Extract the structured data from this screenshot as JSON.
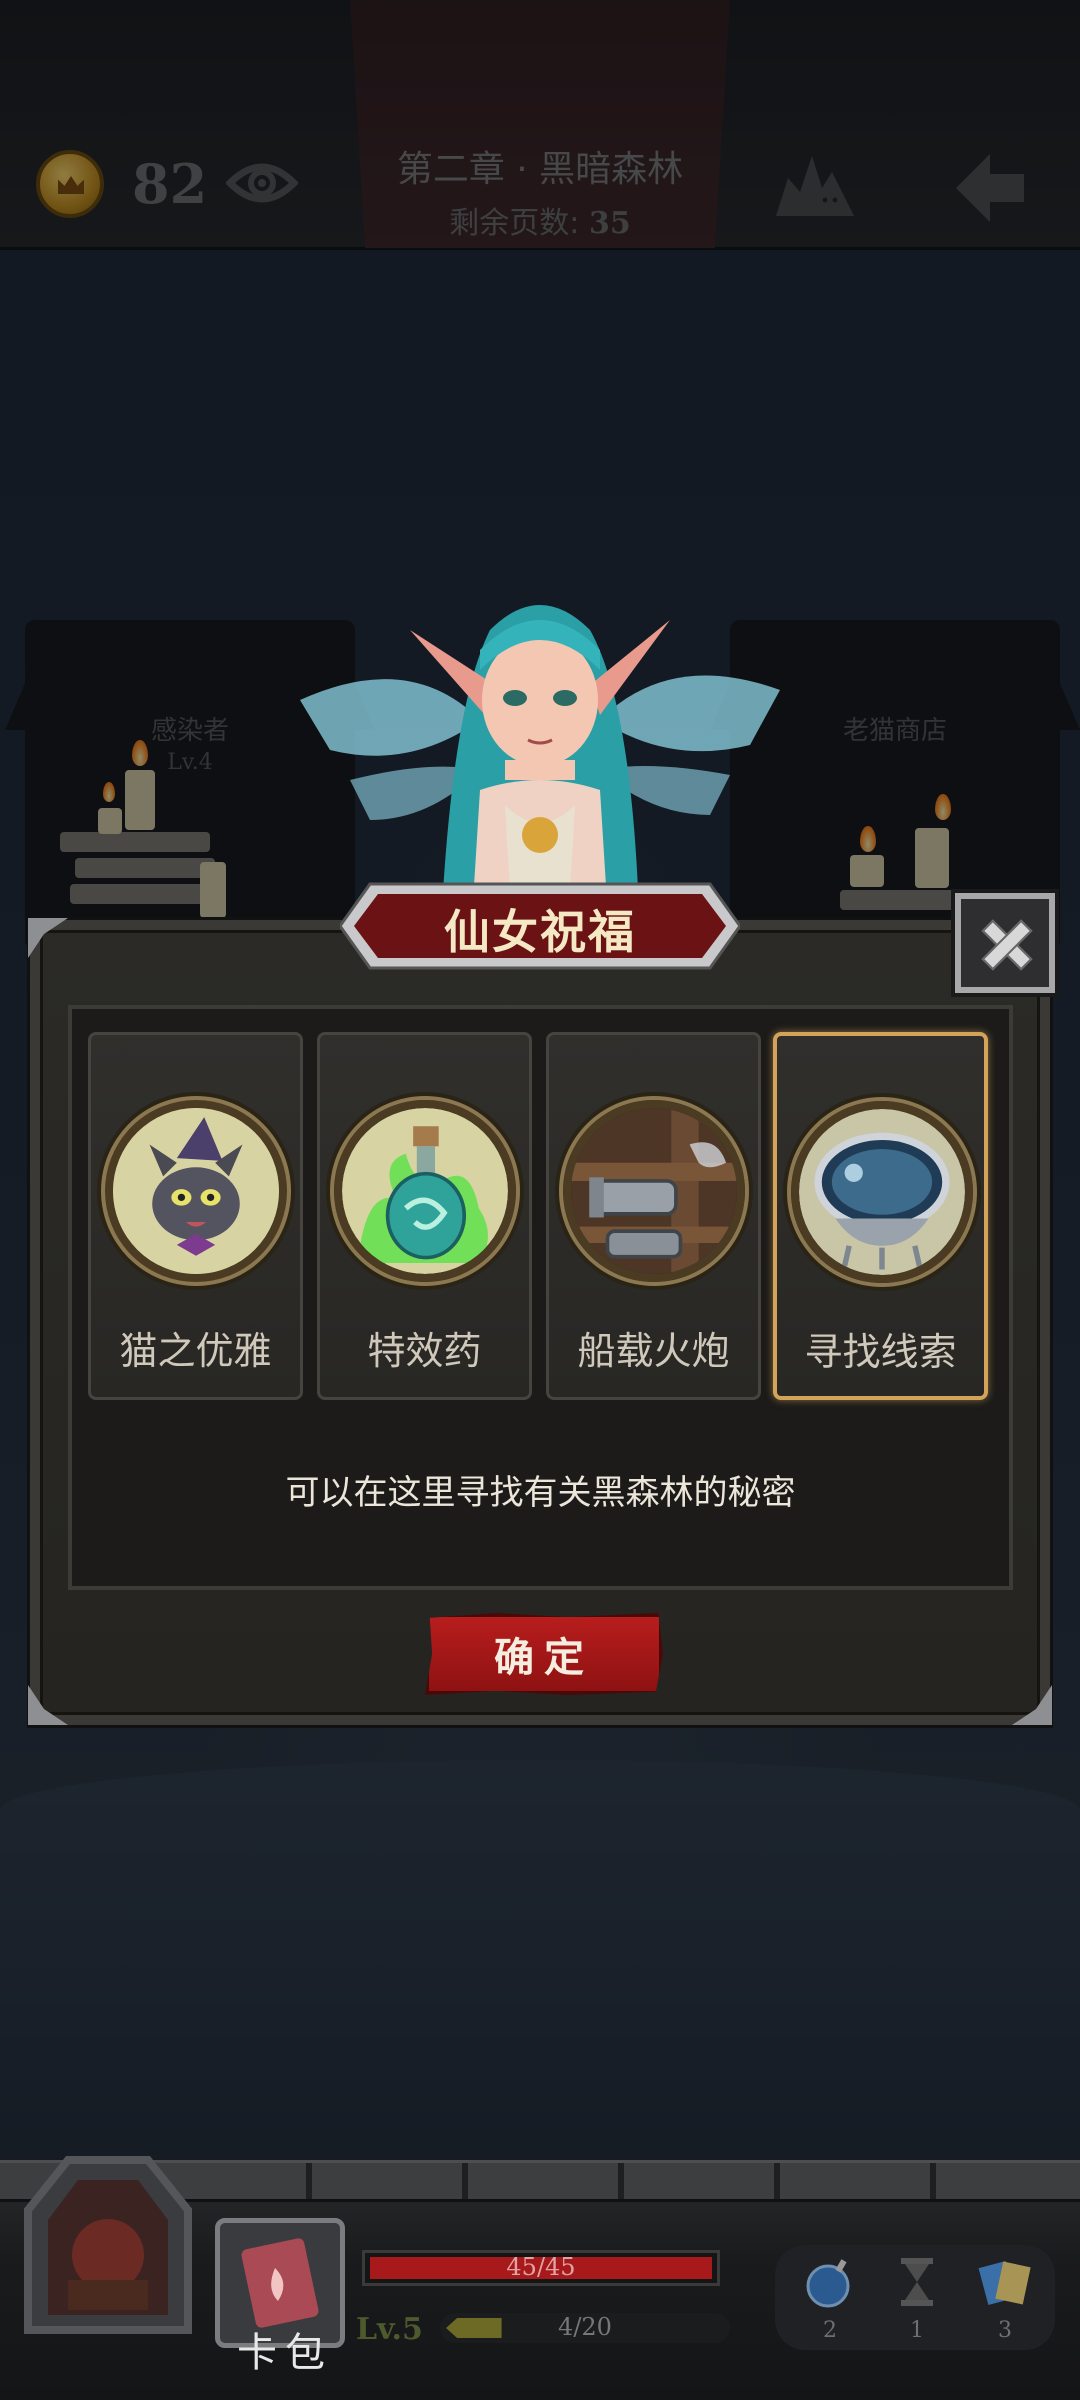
{
  "top_bar": {
    "coin_count": "82",
    "chapter_title": "第二章 · 黑暗森林",
    "pages_label": "剩余页数: ",
    "pages_value": "35"
  },
  "background_cards": [
    {
      "title": "感染者",
      "level": "Lv.4"
    },
    {
      "title": "老猫商店"
    }
  ],
  "dialog": {
    "title": "仙女祝福",
    "options": [
      {
        "label": "猫之优雅",
        "icon": "witch-cat-icon",
        "selected": false
      },
      {
        "label": "特效药",
        "icon": "green-potion-icon",
        "selected": false
      },
      {
        "label": "船载火炮",
        "icon": "ship-cannon-icon",
        "selected": false
      },
      {
        "label": "寻找线索",
        "icon": "crystal-ball-icon",
        "selected": true
      }
    ],
    "description": "可以在这里寻找有关黑森林的秘密",
    "confirm_label": "确定"
  },
  "bottom_bar": {
    "card_pack_label": "卡包",
    "hp_text": "45/45",
    "hp_fraction": 1.0,
    "level_text": "Lv.5",
    "xp_text": "4/20",
    "xp_fraction": 0.2,
    "inventory": [
      {
        "icon": "bomb-icon",
        "count": "2"
      },
      {
        "icon": "hourglass-icon",
        "count": "1"
      },
      {
        "icon": "cards-icon",
        "count": "3"
      }
    ]
  },
  "colors": {
    "accent_red": "#a8191b",
    "selected_border": "#d4a35a",
    "dialog_bg": "#2b2a26"
  }
}
